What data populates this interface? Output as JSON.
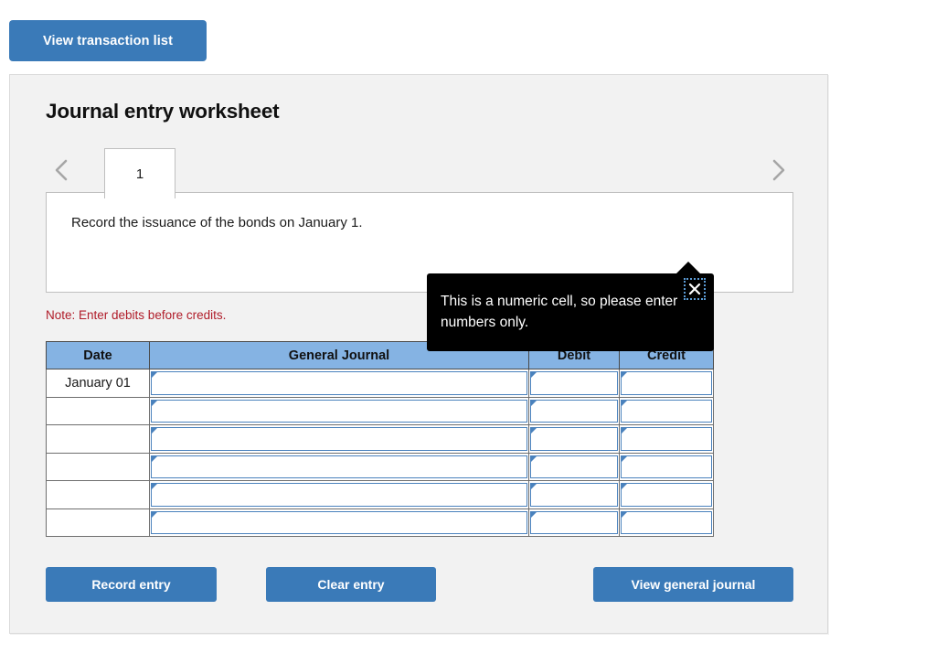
{
  "top_bar": {
    "view_transaction_list_label": "View transaction list"
  },
  "card": {
    "title": "Journal entry worksheet",
    "nav": {
      "prev_icon": "chevron-left-icon",
      "next_icon": "chevron-right-icon"
    },
    "tabs": [
      {
        "label": "1",
        "active": true
      }
    ],
    "description": "Record the issuance of the bonds on January 1.",
    "note": "Note: Enter debits before credits."
  },
  "journal_table": {
    "headers": [
      "Date",
      "General Journal",
      "Debit",
      "Credit"
    ],
    "rows": [
      {
        "date": "January 01",
        "general_journal": "",
        "debit": "",
        "credit": ""
      },
      {
        "date": "",
        "general_journal": "",
        "debit": "",
        "credit": ""
      },
      {
        "date": "",
        "general_journal": "",
        "debit": "",
        "credit": ""
      },
      {
        "date": "",
        "general_journal": "",
        "debit": "",
        "credit": ""
      },
      {
        "date": "",
        "general_journal": "",
        "debit": "",
        "credit": ""
      },
      {
        "date": "",
        "general_journal": "",
        "debit": "",
        "credit": ""
      }
    ]
  },
  "tooltip": {
    "message": "This is a numeric cell, so please enter numbers only.",
    "close_icon": "close-x-icon"
  },
  "actions": {
    "record_entry_label": "Record entry",
    "clear_entry_label": "Clear entry",
    "view_general_journal_label": "View general journal"
  },
  "colors": {
    "button_blue": "#3a7ab8",
    "table_header_blue": "#85b3e3",
    "cell_border_blue": "#4a82bd",
    "note_red": "#b01c29",
    "card_bg": "#f2f2f2",
    "tooltip_bg": "#000000",
    "focus_ring_blue": "#5b9bd5"
  }
}
